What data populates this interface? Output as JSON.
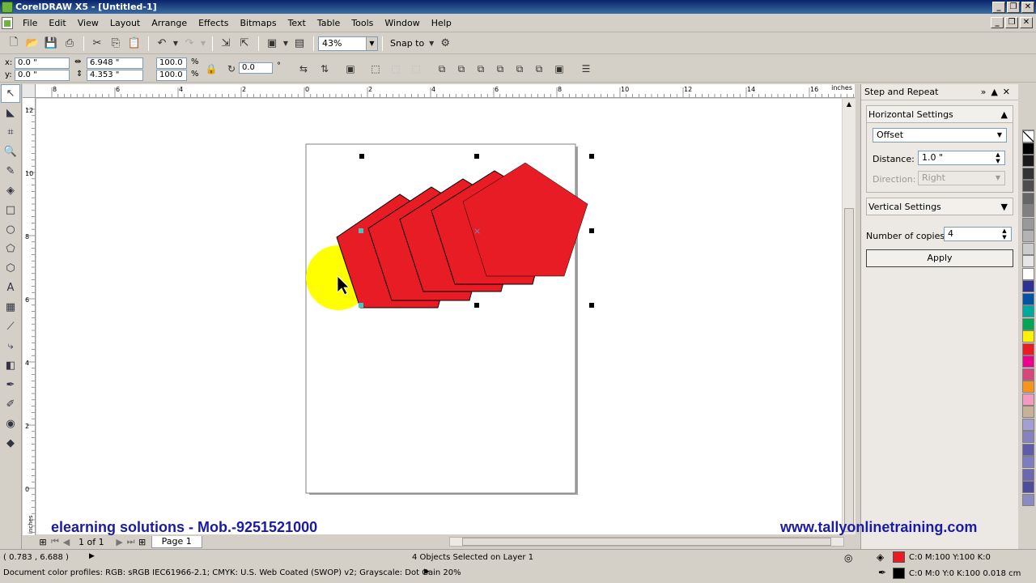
{
  "window": {
    "title": "CorelDRAW X5 - [Untitled-1]"
  },
  "menu": [
    "File",
    "Edit",
    "View",
    "Layout",
    "Arrange",
    "Effects",
    "Bitmaps",
    "Text",
    "Table",
    "Tools",
    "Window",
    "Help"
  ],
  "toolbar": {
    "zoom": "43%",
    "snap_to": "Snap to"
  },
  "properties": {
    "x": "0.0 \"",
    "y": "0.0 \"",
    "width": "6.948 \"",
    "height": "4.353 \"",
    "scale_x": "100.0",
    "scale_y": "100.0",
    "percent": "%",
    "rotation": "0.0",
    "degree": "°"
  },
  "ruler": {
    "unit": "inches",
    "top_labels": [
      "8",
      "6",
      "4",
      "2",
      "0",
      "2",
      "4",
      "6",
      "8",
      "10",
      "12",
      "14",
      "16"
    ],
    "left_labels": [
      "12",
      "10",
      "8",
      "6",
      "4",
      "2",
      "0"
    ],
    "left_unit": "inches"
  },
  "page_nav": {
    "count": "1 of 1",
    "tab": "Page 1"
  },
  "docker": {
    "title": "Step and Repeat",
    "horizontal": {
      "header": "Horizontal Settings",
      "mode": "Offset",
      "distance_label": "Distance:",
      "distance": "1.0 \"",
      "direction_label": "Direction:",
      "direction": "Right"
    },
    "vertical": {
      "header": "Vertical Settings"
    },
    "copies_label": "Number of copies:",
    "copies": "4",
    "apply": "Apply"
  },
  "status": {
    "coords": "( 0.783 , 6.688 )",
    "selection": "4 Objects Selected on Layer 1",
    "color_profiles": "Document color profiles: RGB: sRGB IEC61966-2.1; CMYK: U.S. Web Coated (SWOP) v2; Grayscale: Dot Gain 20%",
    "fill": "C:0 M:100 Y:100 K:0",
    "outline": "C:0 M:0 Y:0 K:100  0.018 cm",
    "fill_color": "#e81c24",
    "outline_color": "#000000"
  },
  "overlay": {
    "left": "elearning solutions - Mob.-9251521000",
    "right": "www.tallyonlinetraining.com"
  },
  "colors": {
    "accent_title": "#0a246a",
    "pentagon_fill": "#e81c24",
    "cursor_highlight": "#ffff00",
    "overlay_text": "#1a1aa8"
  },
  "palette": [
    "#ffffff",
    "#000000",
    "#1a1a1a",
    "#333333",
    "#4d4d4d",
    "#666666",
    "#808080",
    "#999999",
    "#b3b3b3",
    "#cccccc",
    "#e6e6e6",
    "#ffffff",
    "#2e3192",
    "#0054a6",
    "#00a99d",
    "#00a651",
    "#fff200",
    "#ed1c24",
    "#ec008c",
    "#d7467c",
    "#f7941d",
    "#f49ac1",
    "#c7b299",
    "#a39fd0",
    "#8781bd",
    "#605ca8",
    "#7c7ec0",
    "#6a69b0",
    "#4e4d9a",
    "#8b8bc4"
  ]
}
